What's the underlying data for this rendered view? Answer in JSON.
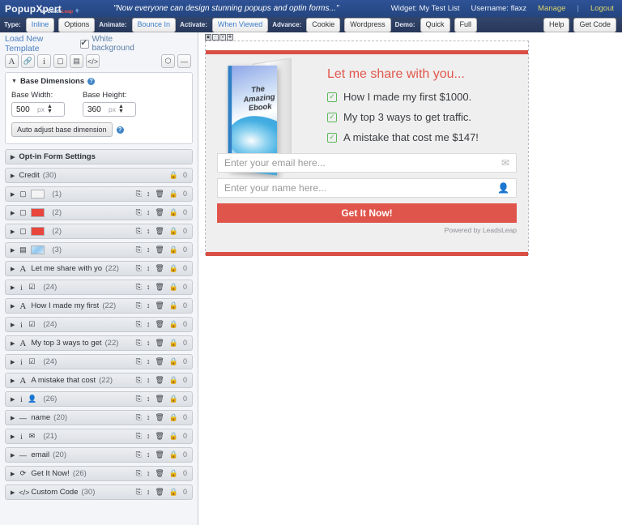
{
  "brandbar": {
    "logo_main": "PopupXpert",
    "logo_sub_by": "by Leads",
    "logo_sub_leap": "Leap",
    "tagline": "\"Now everyone can design stunning popups and optin forms...\"",
    "widget": "Widget: My Test List",
    "username": "Username: flaxz",
    "manage": "Manage",
    "separator": "|",
    "logout": "Logout"
  },
  "toolbar": {
    "groups": [
      {
        "label": "Type:",
        "buttons": [
          {
            "text": "Inline",
            "accent": true
          },
          {
            "text": "Options",
            "accent": false
          }
        ]
      },
      {
        "label": "Animate:",
        "buttons": [
          {
            "text": "Bounce In",
            "accent": true
          }
        ]
      },
      {
        "label": "Activate:",
        "buttons": [
          {
            "text": "When Viewed",
            "accent": true
          }
        ]
      },
      {
        "label": "Advance:",
        "buttons": [
          {
            "text": "Cookie",
            "accent": false
          },
          {
            "text": "Wordpress",
            "accent": false
          }
        ]
      },
      {
        "label": "Demo:",
        "buttons": [
          {
            "text": "Quick",
            "accent": false
          },
          {
            "text": "Full",
            "accent": false
          }
        ]
      }
    ],
    "help": "Help",
    "get_code": "Get Code"
  },
  "leftpanel": {
    "load_new_template": "Load New Template",
    "white_background_label": "White background",
    "white_background_checked": true,
    "tools": [
      {
        "name": "text-tool-icon",
        "glyph": "A"
      },
      {
        "name": "link-tool-icon",
        "glyph": "🔗"
      },
      {
        "name": "info-tool-icon",
        "glyph": "i"
      },
      {
        "name": "shape-tool-icon",
        "glyph": "▢"
      },
      {
        "name": "image-tool-icon",
        "glyph": "▤"
      },
      {
        "name": "code-tool-icon",
        "glyph": "</>"
      }
    ],
    "tools_right": [
      {
        "name": "paint-tool-icon",
        "glyph": "⬡"
      },
      {
        "name": "collapse-tool-icon",
        "glyph": "—"
      }
    ],
    "base_dimensions": {
      "title": "Base Dimensions",
      "width_label": "Base Width:",
      "width_value": "500",
      "height_label": "Base Height:",
      "height_value": "360",
      "unit": "px",
      "auto_adjust_label": "Auto adjust base dimension"
    },
    "optin_settings_label": "Opt-in Form Settings",
    "layers": [
      {
        "icon": "",
        "icon_kind": "none",
        "swatch": "",
        "label": "Credit",
        "count": "(30)",
        "actions": [
          "lock"
        ],
        "num": "0"
      },
      {
        "icon": "▢",
        "icon_kind": "shape",
        "swatch": "white",
        "label": "",
        "count": "(1)",
        "actions": [
          "copy",
          "move",
          "trash",
          "lock"
        ],
        "num": "0"
      },
      {
        "icon": "▢",
        "icon_kind": "shape",
        "swatch": "red",
        "label": "",
        "count": "(2)",
        "actions": [
          "copy",
          "move",
          "trash",
          "lock"
        ],
        "num": "0"
      },
      {
        "icon": "▢",
        "icon_kind": "shape",
        "swatch": "red",
        "label": "",
        "count": "(2)",
        "actions": [
          "copy",
          "move",
          "trash",
          "lock"
        ],
        "num": "0"
      },
      {
        "icon": "▤",
        "icon_kind": "image",
        "swatch": "img",
        "label": "",
        "count": "(3)",
        "actions": [
          "copy",
          "move",
          "trash",
          "lock"
        ],
        "num": "0"
      },
      {
        "icon": "A",
        "icon_kind": "text",
        "swatch": "",
        "label": "Let me share with yo",
        "count": "(22)",
        "actions": [
          "copy",
          "move",
          "trash",
          "lock"
        ],
        "num": "0"
      },
      {
        "icon": "i",
        "icon_kind": "check",
        "swatch": "",
        "label": "",
        "count": "(24)",
        "actions": [
          "copy",
          "move",
          "trash",
          "lock"
        ],
        "num": "0"
      },
      {
        "icon": "A",
        "icon_kind": "text",
        "swatch": "",
        "label": "How I made my first",
        "count": "(22)",
        "actions": [
          "copy",
          "move",
          "trash",
          "lock"
        ],
        "num": "0"
      },
      {
        "icon": "i",
        "icon_kind": "check",
        "swatch": "",
        "label": "",
        "count": "(24)",
        "actions": [
          "copy",
          "move",
          "trash",
          "lock"
        ],
        "num": "0"
      },
      {
        "icon": "A",
        "icon_kind": "text",
        "swatch": "",
        "label": "My top 3 ways to get",
        "count": "(22)",
        "actions": [
          "copy",
          "move",
          "trash",
          "lock"
        ],
        "num": "0"
      },
      {
        "icon": "i",
        "icon_kind": "check",
        "swatch": "",
        "label": "",
        "count": "(24)",
        "actions": [
          "copy",
          "move",
          "trash",
          "lock"
        ],
        "num": "0"
      },
      {
        "icon": "A",
        "icon_kind": "text",
        "swatch": "",
        "label": "A mistake that cost",
        "count": "(22)",
        "actions": [
          "copy",
          "move",
          "trash",
          "lock"
        ],
        "num": "0"
      },
      {
        "icon": "i",
        "icon_kind": "person",
        "swatch": "",
        "label": "",
        "count": "(26)",
        "actions": [
          "copy",
          "move",
          "trash",
          "lock"
        ],
        "num": "0"
      },
      {
        "icon": "—",
        "icon_kind": "field",
        "swatch": "",
        "label": "name",
        "count": "(20)",
        "actions": [
          "copy",
          "move",
          "trash",
          "lock"
        ],
        "num": "0"
      },
      {
        "icon": "i",
        "icon_kind": "mail",
        "swatch": "",
        "label": "",
        "count": "(21)",
        "actions": [
          "copy",
          "move",
          "trash",
          "lock"
        ],
        "num": "0"
      },
      {
        "icon": "—",
        "icon_kind": "field",
        "swatch": "",
        "label": "email",
        "count": "(20)",
        "actions": [
          "copy",
          "move",
          "trash",
          "lock"
        ],
        "num": "0"
      },
      {
        "icon": "⟳",
        "icon_kind": "button",
        "swatch": "",
        "label": "Get It Now!",
        "count": "(26)",
        "actions": [
          "copy",
          "move",
          "trash",
          "lock"
        ],
        "num": "0"
      },
      {
        "icon": "</>",
        "icon_kind": "code",
        "swatch": "",
        "label": "Custom Code",
        "count": "(30)",
        "actions": [
          "copy",
          "move",
          "trash",
          "lock"
        ],
        "num": "0"
      }
    ]
  },
  "canvas": {
    "handles": [
      {
        "name": "save-handle-icon",
        "glyph": "▣"
      },
      {
        "name": "duplicate-handle-icon",
        "glyph": "▫"
      },
      {
        "name": "visibility-handle-icon",
        "glyph": "V"
      },
      {
        "name": "move-handle-icon",
        "glyph": "✥"
      }
    ],
    "popup": {
      "ebook_title_line1": "The Amazing",
      "ebook_title_line2": "Ebook",
      "headline": "Let me share with you...",
      "bullets": [
        "How I made my first $1000.",
        "My top 3 ways to get traffic.",
        "A mistake that cost me $147!"
      ],
      "email_placeholder": "Enter your email here...",
      "name_placeholder": "Enter your name here...",
      "cta_label": "Get It Now!",
      "credit": "Powered by LeadsLeap",
      "accent_color": "#d94f45",
      "headline_color": "#e2574c",
      "check_color": "#5cb85c"
    }
  }
}
